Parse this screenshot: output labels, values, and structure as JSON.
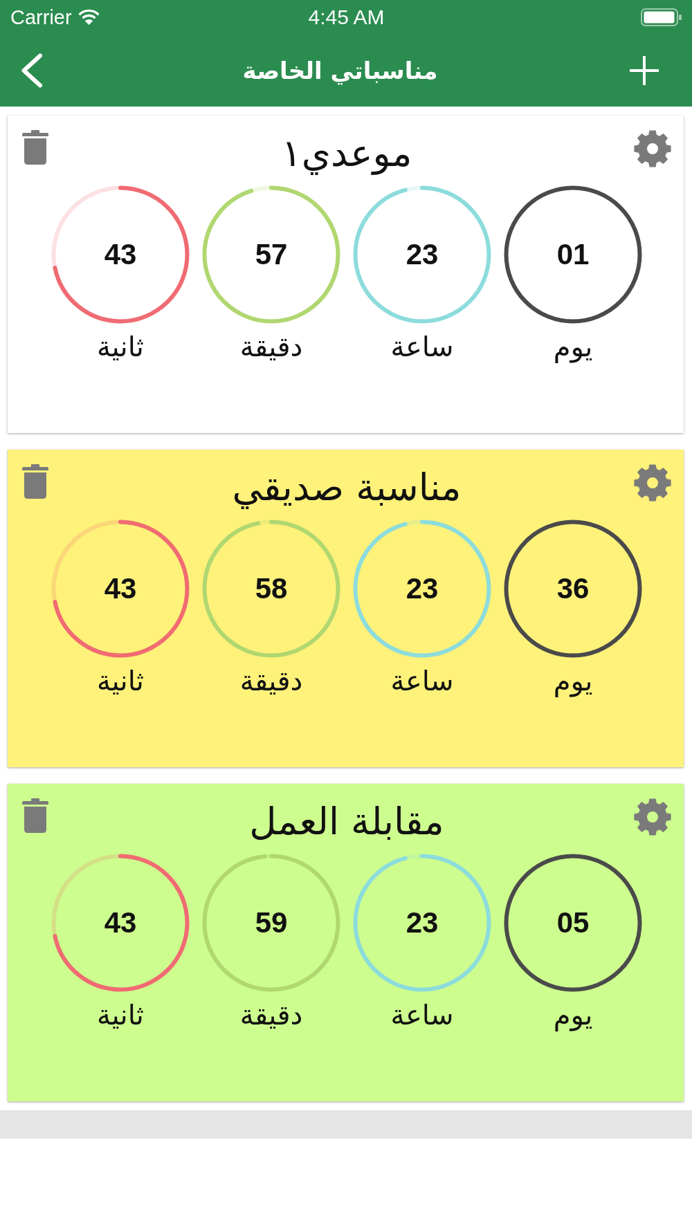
{
  "status_bar": {
    "carrier": "Carrier",
    "time": "4:45 AM"
  },
  "nav_bar": {
    "title": "مناسباتي الخاصة"
  },
  "events": [
    {
      "title": "موعدي١",
      "color": "#ffffff",
      "units": [
        {
          "label": "يوم",
          "value": "01",
          "level": 1,
          "color": "#4a4a4a"
        },
        {
          "label": "ساعة",
          "value": "23",
          "level": 0.958,
          "color": "#8cdcdc"
        },
        {
          "label": "دقيقة",
          "value": "57",
          "level": 0.95,
          "color": "#b0d770"
        },
        {
          "label": "ثانية",
          "value": "43",
          "level": 0.717,
          "color": "#f06b72"
        }
      ]
    },
    {
      "title": "مناسبة صديقي",
      "color": "#fef27a",
      "units": [
        {
          "label": "يوم",
          "value": "36",
          "level": 1,
          "color": "#4a4a4a"
        },
        {
          "label": "ساعة",
          "value": "23",
          "level": 0.958,
          "color": "#8cdcdc"
        },
        {
          "label": "دقيقة",
          "value": "58",
          "level": 0.967,
          "color": "#b0d770"
        },
        {
          "label": "ثانية",
          "value": "43",
          "level": 0.717,
          "color": "#f06b72"
        }
      ]
    },
    {
      "title": "مقابلة العمل",
      "color": "#cdfd8e",
      "units": [
        {
          "label": "يوم",
          "value": "05",
          "level": 1,
          "color": "#4a4a4a"
        },
        {
          "label": "ساعة",
          "value": "23",
          "level": 0.958,
          "color": "#8cdcdc"
        },
        {
          "label": "دقيقة",
          "value": "59",
          "level": 0.983,
          "color": "#b0d770"
        },
        {
          "label": "ثانية",
          "value": "43",
          "level": 0.717,
          "color": "#f06b72"
        }
      ]
    }
  ]
}
